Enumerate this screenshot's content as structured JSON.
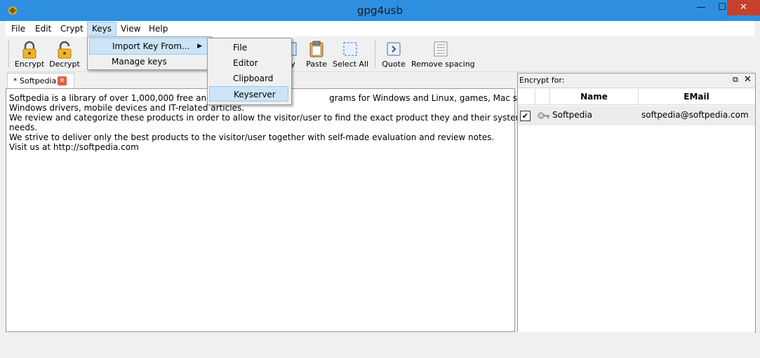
{
  "window": {
    "title": "gpg4usb",
    "min": "—",
    "max": "☐",
    "close": "✕"
  },
  "menubar": [
    {
      "label": "File"
    },
    {
      "label": "Edit"
    },
    {
      "label": "Crypt"
    },
    {
      "label": "Keys"
    },
    {
      "label": "View"
    },
    {
      "label": "Help"
    }
  ],
  "toolbar": {
    "encrypt": "Encrypt",
    "decrypt": "Decrypt",
    "copy": "py",
    "paste": "Paste",
    "select_all": "Select All",
    "quote": "Quote",
    "remove_spacing": "Remove spacing"
  },
  "keys_menu": {
    "import_key_from": "Import Key From...",
    "arrow": "▶",
    "manage_keys": "Manage keys"
  },
  "import_submenu": {
    "file": "File",
    "editor": "Editor",
    "clipboard": "Clipboard",
    "keyserver": "Keyserver"
  },
  "tab": {
    "label": "* Softpedia",
    "close": "✕"
  },
  "editor": {
    "lines": [
      "Softpedia is a library of over 1,000,000 free and fre",
      "Windows drivers, mobile devices and IT-related articles.",
      "We review and categorize these products in order to allow the visitor/user to find the exact product they and their system",
      "needs.",
      "We strive to deliver only the best products to the visitor/user together with self-made evaluation and review notes.",
      "Visit us at http://softpedia.com"
    ],
    "line1_tail": "grams for Windows and Linux, games, Mac software,"
  },
  "encrypt_panel": {
    "title": "Encrypt for:",
    "float_icon": "⧉",
    "close_icon": "✕",
    "columns": {
      "name": "Name",
      "email": "EMail"
    },
    "rows": [
      {
        "checked": "✔",
        "name": "Softpedia",
        "email": "softpedia@softpedia.com"
      }
    ]
  }
}
